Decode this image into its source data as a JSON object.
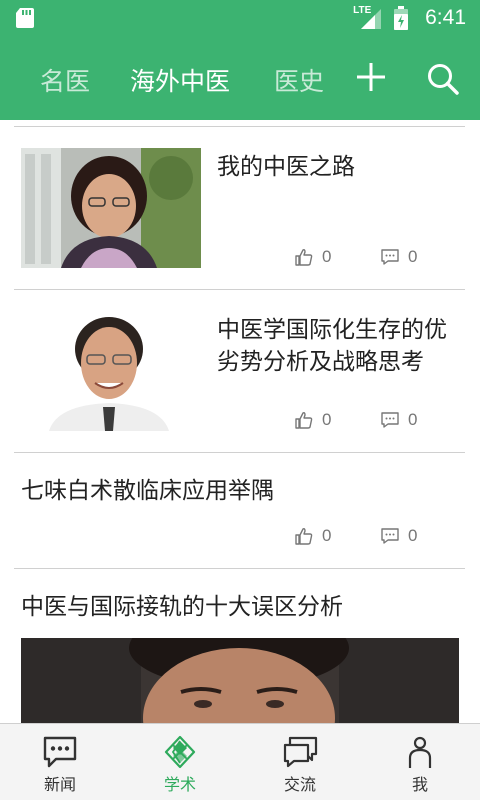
{
  "status_bar": {
    "network_label": "LTE",
    "time": "6:41",
    "icons": [
      "sd-card-icon",
      "signal-icon",
      "battery-icon"
    ]
  },
  "top_nav": {
    "tabs": [
      {
        "label": "名医",
        "active": false
      },
      {
        "label": "海外中医",
        "active": true
      },
      {
        "label": "医史",
        "active": false
      }
    ],
    "icons": [
      "plus-icon",
      "search-icon"
    ],
    "colors": {
      "background": "#3cb371",
      "active_text": "#ffffff"
    }
  },
  "articles": [
    {
      "title": "我的中医之路",
      "likes": "0",
      "comments": "0",
      "has_thumbnail": true
    },
    {
      "title": "中医学国际化生存的优劣势分析及战略思考",
      "likes": "0",
      "comments": "0",
      "has_thumbnail": true
    },
    {
      "title": "七味白术散临床应用举隅",
      "likes": "0",
      "comments": "0",
      "has_thumbnail": false
    },
    {
      "title": "中医与国际接轨的十大误区分析",
      "has_banner_image": true
    }
  ],
  "bottom_nav": {
    "items": [
      {
        "label": "新闻",
        "icon": "chat-bubble-icon",
        "active": false
      },
      {
        "label": "学术",
        "icon": "diamond-grid-icon",
        "active": true
      },
      {
        "label": "交流",
        "icon": "conversation-icon",
        "active": false
      },
      {
        "label": "我",
        "icon": "person-icon",
        "active": false
      }
    ],
    "colors": {
      "active": "#2eaa5c",
      "inactive": "#333333"
    }
  }
}
